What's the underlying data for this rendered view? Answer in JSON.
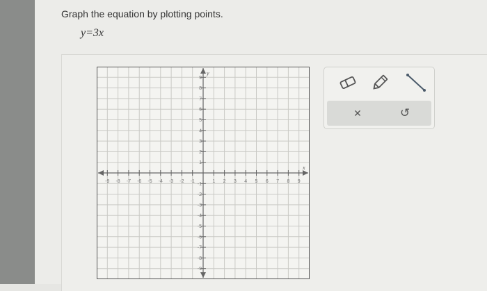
{
  "question": {
    "prompt": "Graph the equation by plotting points.",
    "equation": "y=3x"
  },
  "graph": {
    "x_axis_label": "x",
    "y_axis_label": "y",
    "x_range": [
      -10,
      10
    ],
    "y_range": [
      -10,
      10
    ],
    "x_tick_labels": [
      -9,
      -8,
      -7,
      -6,
      -5,
      -4,
      -3,
      -2,
      -1,
      1,
      2,
      3,
      4,
      5,
      6,
      7,
      8,
      9
    ],
    "y_tick_labels": [
      9,
      8,
      7,
      6,
      5,
      4,
      3,
      2,
      1,
      -1,
      -2,
      -3,
      -4,
      -5,
      -6,
      -7,
      -8,
      -9
    ],
    "grid": true
  },
  "toolbox": {
    "tools": [
      {
        "icon": "eraser-icon"
      },
      {
        "icon": "pencil-icon"
      },
      {
        "icon": "line-tool-icon"
      }
    ],
    "actions": [
      {
        "icon": "close-icon",
        "glyph": "✕"
      },
      {
        "icon": "undo-icon",
        "glyph": "↺"
      }
    ]
  },
  "colors": {
    "grid_line": "#c9c9c5",
    "axis": "#666666",
    "plot_background": "#f4f4f1",
    "tick_text": "#777777"
  }
}
